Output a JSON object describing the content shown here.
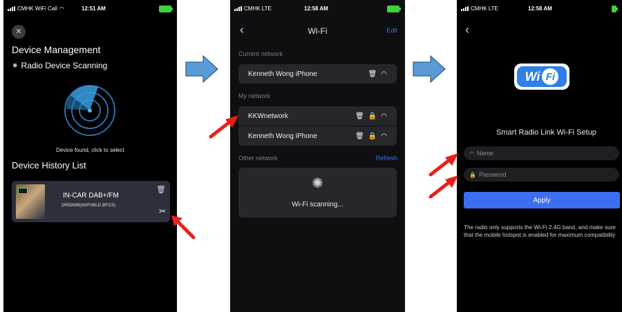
{
  "screens": [
    {
      "status": {
        "carrier": "CMHK WiFi Call",
        "time": "12:51 AM"
      },
      "title": "Device Management",
      "scanning_label": "Radio Device Scanning",
      "found_text": "Device found, click to select",
      "history_title": "Device History List",
      "device": {
        "name": "IN-CAR DAB+/FM",
        "model": "DR59WB(WIFI/BLE-BFC5)"
      }
    },
    {
      "status": {
        "carrier": "CMHK LTE",
        "time": "12:58 AM"
      },
      "title": "Wi-Fi",
      "edit_label": "Edit",
      "current_label": "Current network",
      "current_network": "Kenneth Wong iPhone",
      "my_label": "My network",
      "my_networks": [
        "KKWnetwork",
        "Kenneth Wong iPhone"
      ],
      "other_label": "Other network",
      "refresh_label": "Refresh",
      "scanning_text": "Wi-Fi scanning..."
    },
    {
      "status": {
        "carrier": "CMHK LTE",
        "time": "12:58 AM"
      },
      "logo": {
        "left": "Wi",
        "right": "Fi"
      },
      "title": "Smart Radio Link Wi-Fi Setup",
      "name_placeholder": "Name",
      "password_placeholder": "Password",
      "apply_label": "Apply",
      "note": "The radio only supports the Wi-Fi 2.4G band, and make sure that the mobile hotspot is enabled for maximum compatibility"
    }
  ],
  "colors": {
    "accent": "#3b6ef0",
    "flow_arrow": "#5b9bd5",
    "pointer": "#e8201a"
  }
}
